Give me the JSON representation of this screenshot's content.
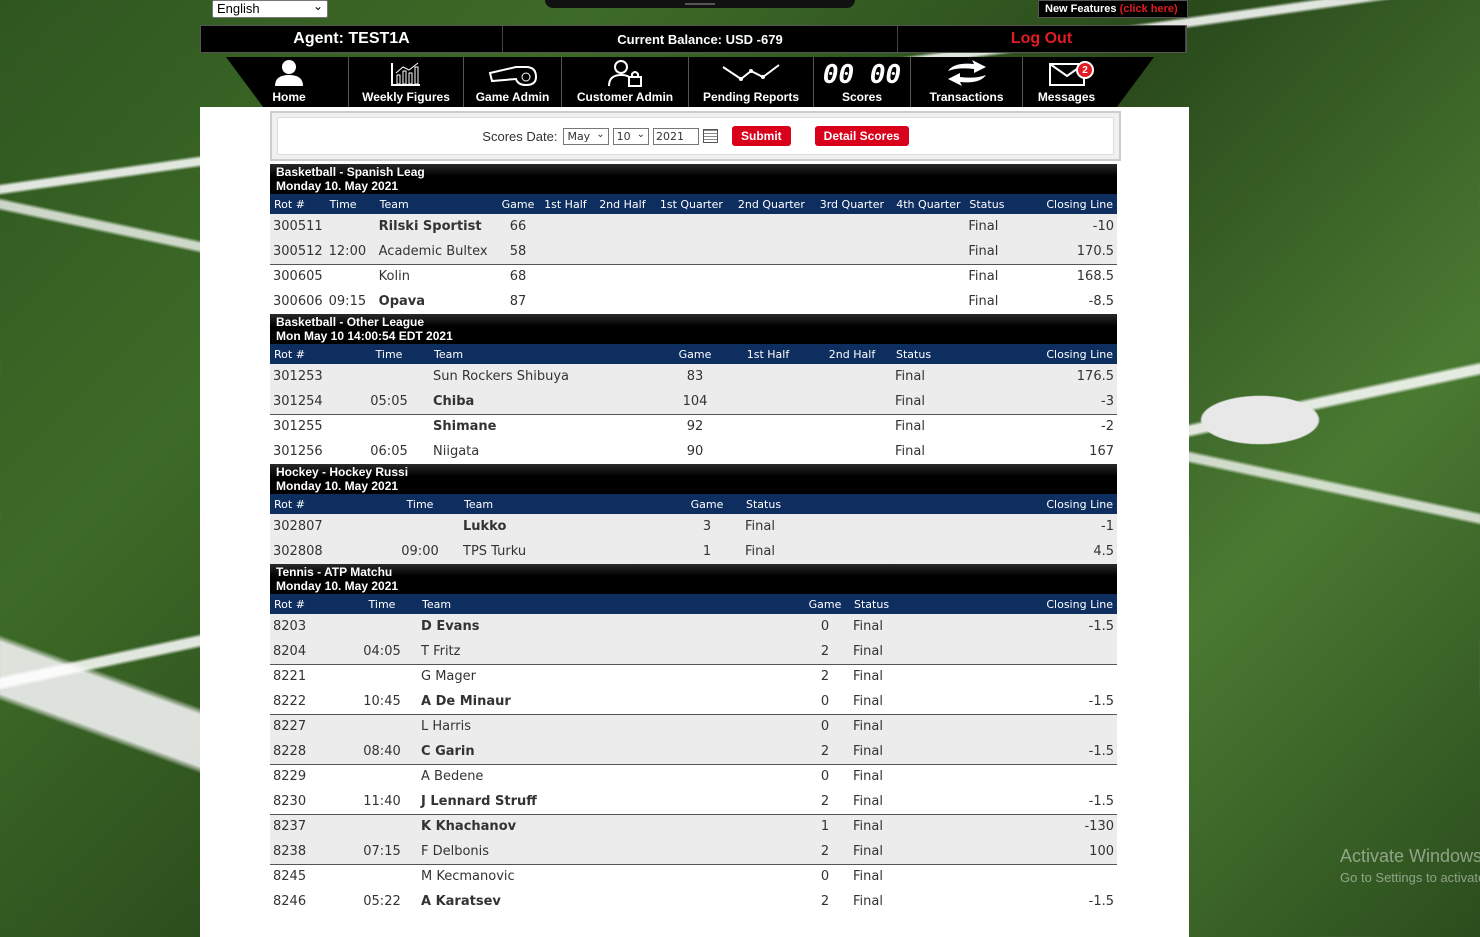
{
  "language": "English",
  "new_features": {
    "label": "New Features",
    "link": "(click here)"
  },
  "agent_bar": {
    "agent": "Agent: TEST1A",
    "balance": "Current Balance: USD -679",
    "logout": "Log Out"
  },
  "nav": {
    "items": [
      {
        "label": "Home",
        "icon": "user-icon"
      },
      {
        "label": "Weekly Figures",
        "icon": "bar-chart-icon"
      },
      {
        "label": "Game Admin",
        "icon": "whistle-icon"
      },
      {
        "label": "Customer Admin",
        "icon": "user-lock-icon"
      },
      {
        "label": "Pending Reports",
        "icon": "line-chart-icon"
      },
      {
        "label": "Scores",
        "icon": "scoreboard-icon",
        "glyph": "00 00"
      },
      {
        "label": "Transactions",
        "icon": "exchange-icon"
      },
      {
        "label": "Messages",
        "icon": "envelope-icon",
        "badge": "2"
      }
    ]
  },
  "date_form": {
    "label": "Scores Date:",
    "month": "May",
    "day": "10",
    "year": "2021",
    "submit": "Submit",
    "detail": "Detail Scores"
  },
  "sections": [
    {
      "title": "Basketball - Spanish Leag",
      "date": "Monday 10. May 2021",
      "headers": [
        "Rot #",
        "Time",
        "Team",
        "Game",
        "1st Half",
        "2nd Half",
        "1st Quarter",
        "2nd Quarter",
        "3rd Quarter",
        "4th Quarter",
        "Status",
        "Closing Line"
      ],
      "rows": [
        {
          "rot": "300511",
          "time": "",
          "team": "Rilski Sportist",
          "bold": true,
          "game": "66",
          "status": "Final",
          "line": "-10"
        },
        {
          "rot": "300512",
          "time": "12:00",
          "team": "Academic Bultex",
          "bold": false,
          "game": "58",
          "status": "Final",
          "line": "170.5"
        },
        {
          "rot": "300605",
          "time": "",
          "team": "Kolin",
          "bold": false,
          "game": "68",
          "status": "Final",
          "line": "168.5"
        },
        {
          "rot": "300606",
          "time": "09:15",
          "team": "Opava",
          "bold": true,
          "game": "87",
          "status": "Final",
          "line": "-8.5"
        }
      ]
    },
    {
      "title": "Basketball - Other League",
      "date": "Mon May 10 14:00:54 EDT 2021",
      "headers": [
        "Rot #",
        "Time",
        "Team",
        "Game",
        "1st Half",
        "2nd Half",
        "Status",
        "Closing Line"
      ],
      "rows": [
        {
          "rot": "301253",
          "time": "",
          "team": "Sun Rockers Shibuya",
          "bold": false,
          "game": "83",
          "status": "Final",
          "line": "176.5"
        },
        {
          "rot": "301254",
          "time": "05:05",
          "team": "Chiba",
          "bold": true,
          "game": "104",
          "status": "Final",
          "line": "-3"
        },
        {
          "rot": "301255",
          "time": "",
          "team": "Shimane",
          "bold": true,
          "game": "92",
          "status": "Final",
          "line": "-2"
        },
        {
          "rot": "301256",
          "time": "06:05",
          "team": "Niigata",
          "bold": false,
          "game": "90",
          "status": "Final",
          "line": "167"
        }
      ]
    },
    {
      "title": "Hockey - Hockey Russi",
      "date": "Monday 10. May 2021",
      "headers": [
        "Rot #",
        "Time",
        "Team",
        "Game",
        "Status",
        "Closing Line"
      ],
      "rows": [
        {
          "rot": "302807",
          "time": "",
          "team": "Lukko",
          "bold": true,
          "game": "3",
          "status": "Final",
          "line": "-1"
        },
        {
          "rot": "302808",
          "time": "09:00",
          "team": "TPS Turku",
          "bold": false,
          "game": "1",
          "status": "Final",
          "line": "4.5"
        }
      ]
    },
    {
      "title": "Tennis - ATP Matchu",
      "date": "Monday 10. May 2021",
      "headers": [
        "Rot #",
        "Time",
        "Team",
        "Game",
        "Status",
        "Closing Line"
      ],
      "rows": [
        {
          "rot": "8203",
          "time": "",
          "team": "D Evans",
          "bold": true,
          "game": "0",
          "status": "Final",
          "line": "-1.5"
        },
        {
          "rot": "8204",
          "time": "04:05",
          "team": "T Fritz",
          "bold": false,
          "game": "2",
          "status": "Final",
          "line": ""
        },
        {
          "rot": "8221",
          "time": "",
          "team": "G Mager",
          "bold": false,
          "game": "2",
          "status": "Final",
          "line": ""
        },
        {
          "rot": "8222",
          "time": "10:45",
          "team": "A De Minaur",
          "bold": true,
          "game": "0",
          "status": "Final",
          "line": "-1.5"
        },
        {
          "rot": "8227",
          "time": "",
          "team": "L Harris",
          "bold": false,
          "game": "0",
          "status": "Final",
          "line": ""
        },
        {
          "rot": "8228",
          "time": "08:40",
          "team": "C Garin",
          "bold": true,
          "game": "2",
          "status": "Final",
          "line": "-1.5"
        },
        {
          "rot": "8229",
          "time": "",
          "team": "A Bedene",
          "bold": false,
          "game": "0",
          "status": "Final",
          "line": ""
        },
        {
          "rot": "8230",
          "time": "11:40",
          "team": "J Lennard Struff",
          "bold": true,
          "game": "2",
          "status": "Final",
          "line": "-1.5"
        },
        {
          "rot": "8237",
          "time": "",
          "team": "K Khachanov",
          "bold": true,
          "game": "1",
          "status": "Final",
          "line": "-130"
        },
        {
          "rot": "8238",
          "time": "07:15",
          "team": "F Delbonis",
          "bold": false,
          "game": "2",
          "status": "Final",
          "line": "100"
        },
        {
          "rot": "8245",
          "time": "",
          "team": "M Kecmanovic",
          "bold": false,
          "game": "0",
          "status": "Final",
          "line": ""
        },
        {
          "rot": "8246",
          "time": "05:22",
          "team": "A Karatsev",
          "bold": true,
          "game": "2",
          "status": "Final",
          "line": "-1.5"
        }
      ]
    }
  ],
  "watermark": {
    "line1": "Activate Windows",
    "line2": "Go to Settings to activate Windows."
  },
  "colors": {
    "accent_red": "#d9001b",
    "header_blue": "#0e2e60"
  }
}
